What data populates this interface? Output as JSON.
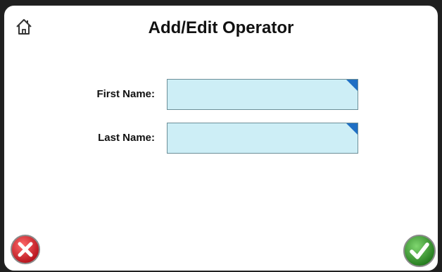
{
  "header": {
    "title": "Add/Edit Operator",
    "home_icon": "home-icon"
  },
  "form": {
    "first_name": {
      "label": "First Name:",
      "value": "",
      "placeholder": ""
    },
    "last_name": {
      "label": "Last Name:",
      "value": "",
      "placeholder": ""
    }
  },
  "footer": {
    "cancel_icon": "cancel-x-icon",
    "confirm_icon": "confirm-check-icon"
  },
  "colors": {
    "field_bg": "#cdeef6",
    "field_corner": "#1f6fc4",
    "cancel": "#d9232a",
    "confirm": "#3aa232"
  }
}
